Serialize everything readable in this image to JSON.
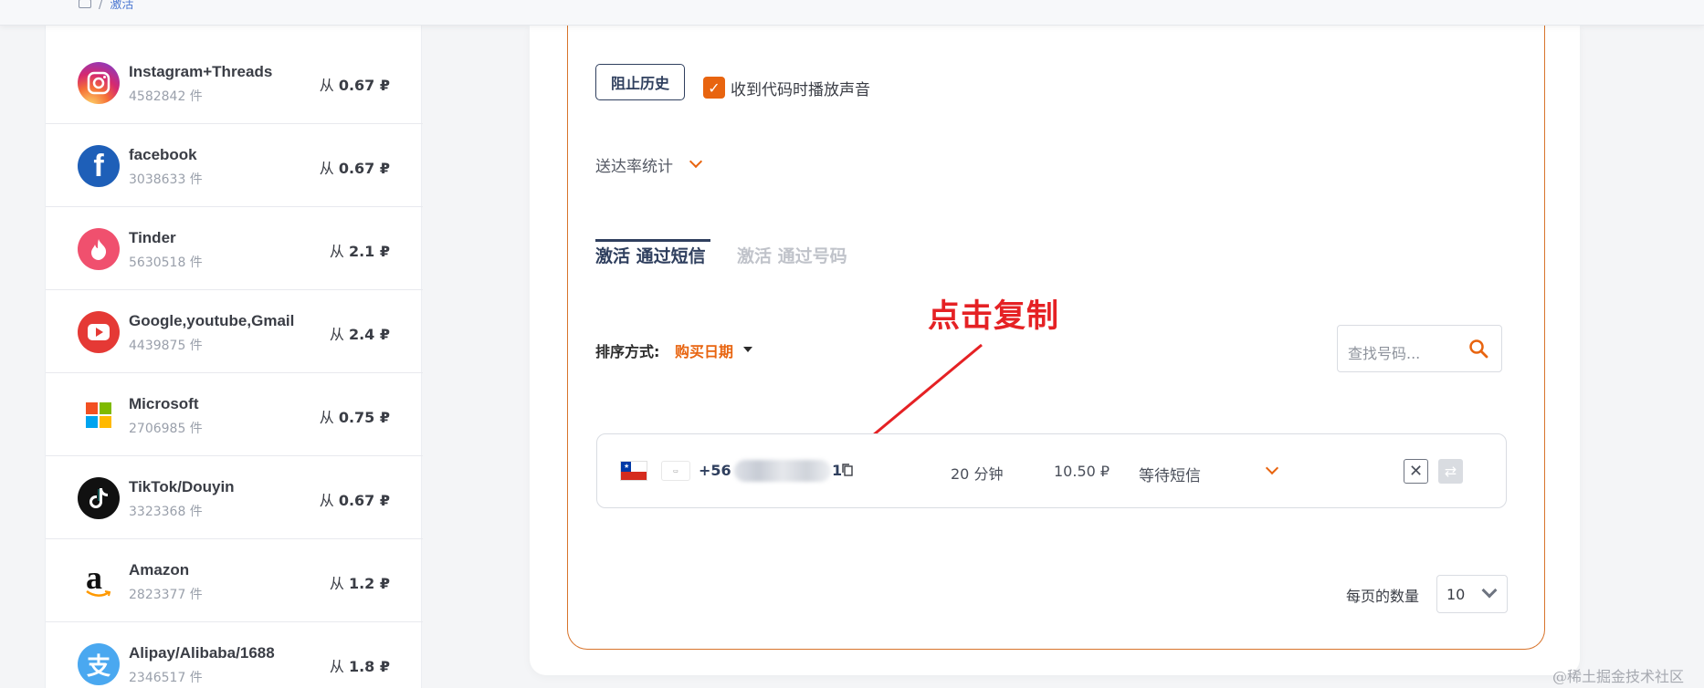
{
  "breadcrumb": {
    "current": "激活"
  },
  "services": [
    {
      "name": "Instagram+Threads",
      "count": "4582842 件",
      "price_prefix": "从",
      "price": "0.67 ₽",
      "icon": "instagram-icon",
      "color": "#d6296f"
    },
    {
      "name": "facebook",
      "count": "3038633 件",
      "price_prefix": "从",
      "price": "0.67 ₽",
      "icon": "facebook-icon",
      "color": "#1877f2"
    },
    {
      "name": "Tinder",
      "count": "5630518 件",
      "price_prefix": "从",
      "price": "2.1 ₽",
      "icon": "tinder-icon",
      "color": "#f0506e"
    },
    {
      "name": "Google,youtube,Gmail",
      "count": "4439875 件",
      "price_prefix": "从",
      "price": "2.4 ₽",
      "icon": "youtube-icon",
      "color": "#e53935"
    },
    {
      "name": "Microsoft",
      "count": "2706985 件",
      "price_prefix": "从",
      "price": "0.75 ₽",
      "icon": "microsoft-icon",
      "color": "#ffffff"
    },
    {
      "name": "TikTok/Douyin",
      "count": "3323368 件",
      "price_prefix": "从",
      "price": "0.67 ₽",
      "icon": "tiktok-icon",
      "color": "#111111"
    },
    {
      "name": "Amazon",
      "count": "2823377 件",
      "price_prefix": "从",
      "price": "1.2 ₽",
      "icon": "amazon-icon",
      "color": "#ffffff"
    },
    {
      "name": "Alipay/Alibaba/1688",
      "count": "2346517 件",
      "price_prefix": "从",
      "price": "1.8 ₽",
      "icon": "alipay-icon",
      "color": "#4aa8f0"
    }
  ],
  "controls": {
    "history_button": "阻止历史",
    "sound_checkbox_label": "收到代码时播放声音",
    "sound_checked": true,
    "stats_toggle": "送达率统计"
  },
  "tabs": {
    "sms": "激活 通过短信",
    "number": "激活 通过号码"
  },
  "annotation": "点击复制",
  "sort": {
    "label": "排序方式:",
    "value": "购买日期"
  },
  "search": {
    "placeholder": "查找号码..."
  },
  "order": {
    "phone_prefix": "+56",
    "phone_suffix": "1",
    "time": "20 分钟",
    "price": "10.50 ₽",
    "status": "等待短信"
  },
  "pagination": {
    "label": "每页的数量",
    "value": "10"
  },
  "watermark": "@稀土掘金技术社区",
  "colors": {
    "accent": "#e8640f",
    "navy": "#2f3f5e",
    "annotation": "#e52124"
  }
}
